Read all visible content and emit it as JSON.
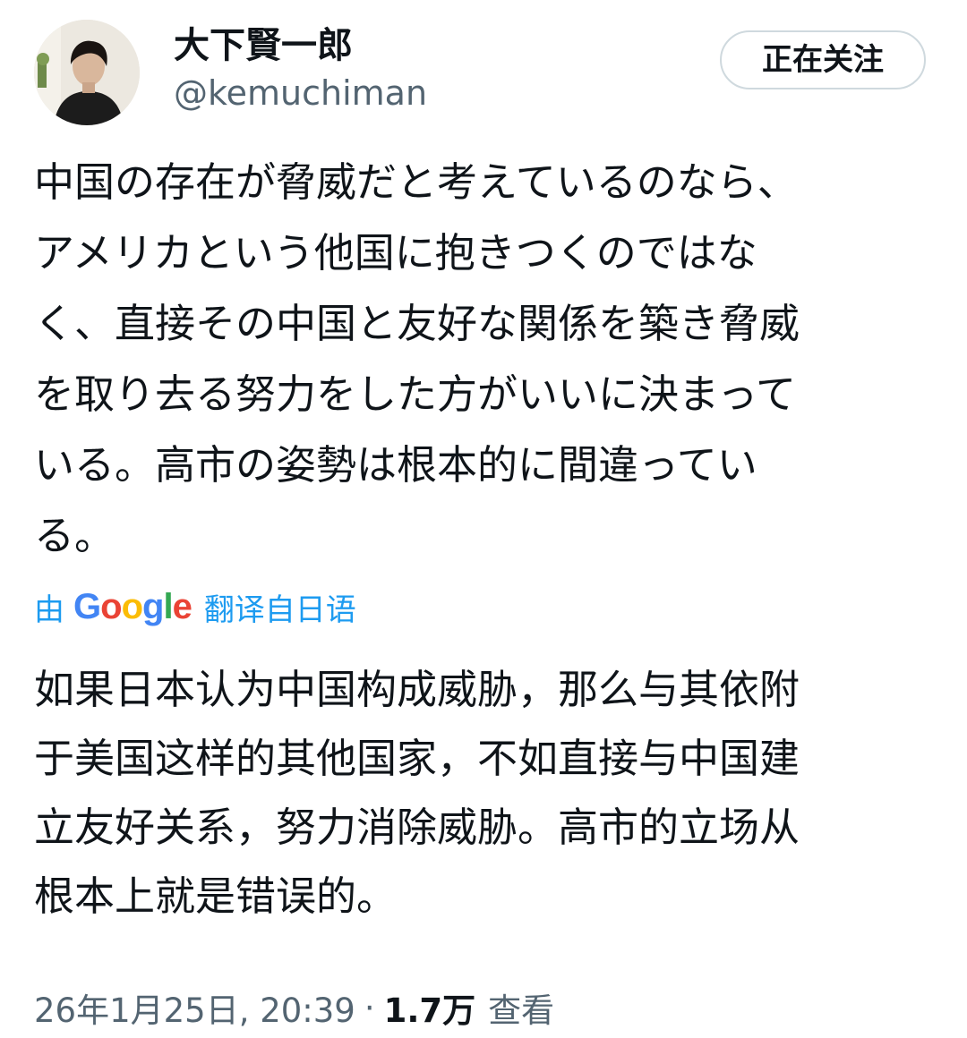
{
  "author": {
    "display_name": "大下賢一郎",
    "handle": "@kemuchiman"
  },
  "follow_button": {
    "label": "正在关注"
  },
  "tweet": {
    "lines": [
      "中国の存在が脅威だと考えているのなら、",
      "アメリカという他国に抱きつくのではな",
      "く、直接その中国と友好な関係を築き脅威",
      "を取り去る努力をした方がいいに決まって",
      "いる。高市の姿勢は根本的に間違ってい",
      "る。"
    ]
  },
  "translation": {
    "prefix": "由",
    "provider_letters": [
      "G",
      "o",
      "o",
      "g",
      "l",
      "e"
    ],
    "provider_colors": [
      "#4285f4",
      "#ea4335",
      "#fbbc05",
      "#4285f4",
      "#34a853",
      "#ea4335"
    ],
    "suffix": "翻译自日语",
    "lines": [
      "如果日本认为中国构成威胁，那么与其依附",
      "于美国这样的其他国家，不如直接与中国建",
      "立友好关系，努力消除威胁。高市的立场从",
      "根本上就是错误的。"
    ]
  },
  "meta": {
    "timestamp": "26年1月25日, 20:39",
    "separator": "·",
    "views_count": "1.7万",
    "views_label": "查看"
  },
  "colors": {
    "accent": "#1d9bf0",
    "secondary_text": "#536471",
    "button_border": "#cfd9de"
  }
}
